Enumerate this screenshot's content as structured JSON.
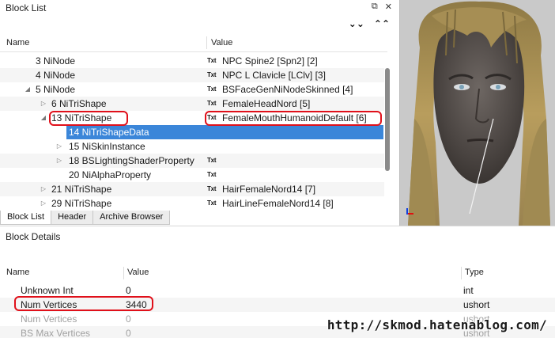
{
  "block_list": {
    "title": "Block List",
    "title_buttons": [
      "⧉",
      "✕"
    ],
    "collapse_buttons": [
      "⯯",
      "⯭"
    ],
    "col_name": "Name",
    "col_value": "Value",
    "rows": [
      {
        "name": "3 NiNode",
        "value": "NPC Spine2 [Spn2] [2]",
        "txt": "Txt"
      },
      {
        "name": "4 NiNode",
        "value": "NPC L Clavicle [LClv] [3]",
        "txt": "Txt"
      },
      {
        "name": "5 NiNode",
        "value": "BSFaceGenNiNodeSkinned [4]",
        "txt": "Txt",
        "arrow": "◢"
      },
      {
        "name": "6 NiTriShape",
        "value": "FemaleHeadNord [5]",
        "txt": "Txt",
        "arrow": "▷"
      },
      {
        "name": "13 NiTriShape",
        "value": "FemaleMouthHumanoidDefault [6]",
        "txt": "Txt",
        "arrow": "◢"
      },
      {
        "name": "14 NiTriShapeData",
        "value": "",
        "txt": ""
      },
      {
        "name": "15 NiSkinInstance",
        "value": "",
        "txt": "",
        "arrow": "▷"
      },
      {
        "name": "18 BSLightingShaderProperty",
        "value": "",
        "txt": "Txt",
        "arrow": "▷"
      },
      {
        "name": "20 NiAlphaProperty",
        "value": "",
        "txt": "Txt"
      },
      {
        "name": "21 NiTriShape",
        "value": "HairFemaleNord14 [7]",
        "txt": "Txt",
        "arrow": "▷"
      },
      {
        "name": "29 NiTriShape",
        "value": "HairLineFemaleNord14 [8]",
        "txt": "Txt",
        "arrow": "▷"
      }
    ]
  },
  "tabs": [
    "Block List",
    "Header",
    "Archive Browser"
  ],
  "block_details": {
    "title": "Block Details",
    "col_name": "Name",
    "col_value": "Value",
    "col_type": "Type",
    "rows": [
      {
        "name": "Unknown Int",
        "value": "0",
        "type": "int"
      },
      {
        "name": "Num Vertices",
        "value": "3440",
        "type": "ushort"
      },
      {
        "name": "Num Vertices",
        "value": "0",
        "type": "ushort"
      },
      {
        "name": "BS Max Vertices",
        "value": "0",
        "type": "ushort"
      }
    ]
  },
  "watermark": "http://skmod.hatenablog.com/",
  "colors": {
    "selection": "#3b86d9",
    "highlight_box": "#e0101a",
    "render_bg": "#c9c9c9"
  }
}
